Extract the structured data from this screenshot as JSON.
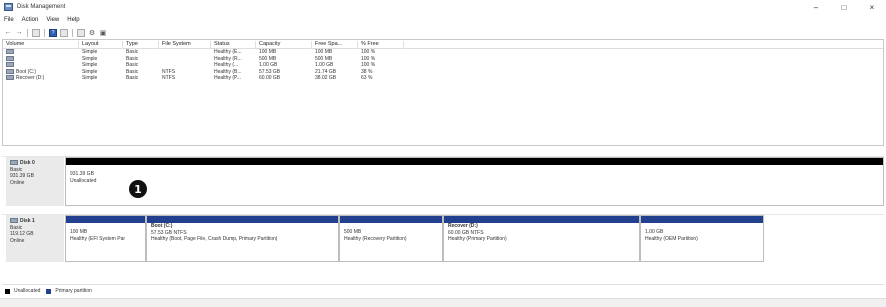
{
  "window": {
    "title": "Disk Management",
    "controls": [
      "–",
      "□",
      "×"
    ]
  },
  "menu": [
    "File",
    "Action",
    "View",
    "Help"
  ],
  "toolbar": {
    "icons": [
      "back-arrow-icon",
      "forward-arrow-icon",
      "list-view-icon",
      "help-icon",
      "disk-view-icon",
      "properties-icon",
      "settings-icon",
      "refresh-icon"
    ]
  },
  "volumes": {
    "columns": [
      "Volume",
      "Layout",
      "Type",
      "File System",
      "Status",
      "Capacity",
      "Free Spa...",
      "% Free"
    ],
    "rows": [
      [
        "",
        "Simple",
        "Basic",
        "",
        "Healthy (E...",
        "100 MB",
        "100 MB",
        "100 %"
      ],
      [
        "",
        "Simple",
        "Basic",
        "",
        "Healthy (R...",
        "500 MB",
        "500 MB",
        "100 %"
      ],
      [
        "",
        "Simple",
        "Basic",
        "",
        "Healthy (...",
        "1.00 GB",
        "1.00 GB",
        "100 %"
      ],
      [
        "Boot (C:)",
        "Simple",
        "Basic",
        "NTFS",
        "Healthy (B...",
        "57.53 GB",
        "21.74 GB",
        "38 %"
      ],
      [
        "Recover (D:)",
        "Simple",
        "Basic",
        "NTFS",
        "Healthy (P...",
        "60.00 GB",
        "38.02 GB",
        "63 %"
      ]
    ]
  },
  "disk0": {
    "name": "Disk 0",
    "type": "Basic",
    "size": "931.39 GB",
    "state": "Online",
    "partitions": [
      {
        "size": "931.39 GB",
        "status": "Unallocated"
      }
    ]
  },
  "disk1": {
    "name": "Disk 1",
    "type": "Basic",
    "size": "119.12 GB",
    "state": "Online",
    "partitions": [
      {
        "name": "",
        "size": "100 MB",
        "status": "Healthy (EFI System Par"
      },
      {
        "name": "Boot (C:)",
        "size": "57.53 GB NTFS",
        "status": "Healthy (Boot, Page File, Crash Dump, Primary Partition)"
      },
      {
        "name": "",
        "size": "500 MB",
        "status": "Healthy (Recovery Partition)"
      },
      {
        "name": "Recover (D:)",
        "size": "60.00 GB NTFS",
        "status": "Healthy (Primary Partition)"
      },
      {
        "name": "",
        "size": "1.00 GB",
        "status": "Healthy (OEM Partition)"
      }
    ]
  },
  "annotation": {
    "marker": "1"
  },
  "legend": [
    {
      "label": "Unallocated",
      "color": "#000000"
    },
    {
      "label": "Primary partition",
      "color": "#21418e"
    }
  ]
}
